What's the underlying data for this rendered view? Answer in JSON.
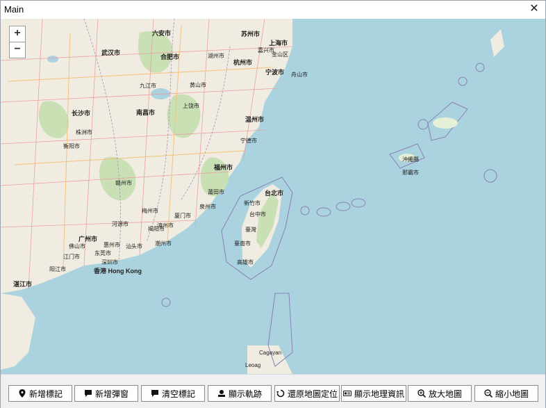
{
  "window": {
    "title": "Main",
    "close_symbol": "✕"
  },
  "map": {
    "zoom_in": "+",
    "zoom_out": "−",
    "places": [
      "六安市",
      "合肥市",
      "湖州市",
      "杭州市",
      "苏州市",
      "嘉兴市",
      "上海市",
      "金山区",
      "宁波市",
      "舟山市",
      "温州市",
      "福州市",
      "宁德市",
      "莆田市",
      "泉州市",
      "厦门市",
      "漳州市",
      "汕头市",
      "潮州市",
      "揭阳市",
      "梅州市",
      "河源市",
      "惠州市",
      "深圳市",
      "东莞市",
      "广州市",
      "佛山市",
      "江门市",
      "香港 Hong Kong",
      "湛江市",
      "阳江市",
      "南昌市",
      "赣州市",
      "长沙市",
      "株洲市",
      "衡阳市",
      "武汉市",
      "九江市",
      "黄山市",
      "上饶市",
      "台北市",
      "新竹市",
      "台中市",
      "臺灣",
      "臺南市",
      "高雄市",
      "沖繩縣",
      "那霸市",
      "Cagayan",
      "Leoag"
    ]
  },
  "toolbar": {
    "buttons": [
      {
        "label": "新增標記",
        "icon": "marker-icon"
      },
      {
        "label": "新增彈窗",
        "icon": "popup-icon"
      },
      {
        "label": "清空標記",
        "icon": "clear-icon"
      },
      {
        "label": "顯示軌跡",
        "icon": "track-icon"
      },
      {
        "label": "還原地圖定位",
        "icon": "restore-icon"
      },
      {
        "label": "顯示地理資訊",
        "icon": "info-icon"
      },
      {
        "label": "放大地圖",
        "icon": "zoom-in-icon"
      },
      {
        "label": "縮小地圖",
        "icon": "zoom-out-icon"
      }
    ]
  }
}
